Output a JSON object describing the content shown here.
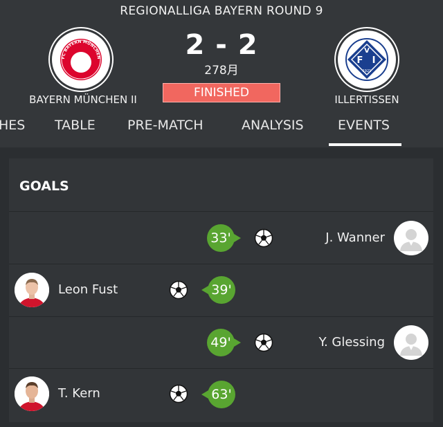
{
  "match": {
    "league_round": "REGIONALLIGA  BAYERN ROUND 9",
    "home_team": "BAYERN MÜNCHEN II",
    "away_team": "ILLERTISSEN",
    "score": "2 - 2",
    "attendance": "278月",
    "status": "FINISHED",
    "home_crest_text": "FC BAYERN MÜNCHEN",
    "away_crest_letters": [
      "F",
      "V",
      "I"
    ],
    "away_crest_year": "1921"
  },
  "tabs": [
    {
      "label": "HES"
    },
    {
      "label": "TABLE"
    },
    {
      "label": "PRE-MATCH"
    },
    {
      "label": "ANALYSIS"
    },
    {
      "label": "EVENTS",
      "active": true
    }
  ],
  "goals": {
    "title": "GOALS",
    "events": [
      {
        "minute": "33'",
        "player": "J. Wanner",
        "side": "away"
      },
      {
        "minute": "39'",
        "player": "Leon Fust",
        "side": "home"
      },
      {
        "minute": "49'",
        "player": "Y. Glessing",
        "side": "away"
      },
      {
        "minute": "63'",
        "player": "T. Kern",
        "side": "home"
      }
    ]
  },
  "colors": {
    "status_bg": "#f1675f",
    "minute_bg": "#59a531",
    "bayern_red": "#dc052d",
    "bayern_blue": "#0066b2",
    "illertissen_blue": "#1a3f8f"
  },
  "icons": [
    "ball-icon",
    "avatar-placeholder-icon",
    "player-photo"
  ]
}
